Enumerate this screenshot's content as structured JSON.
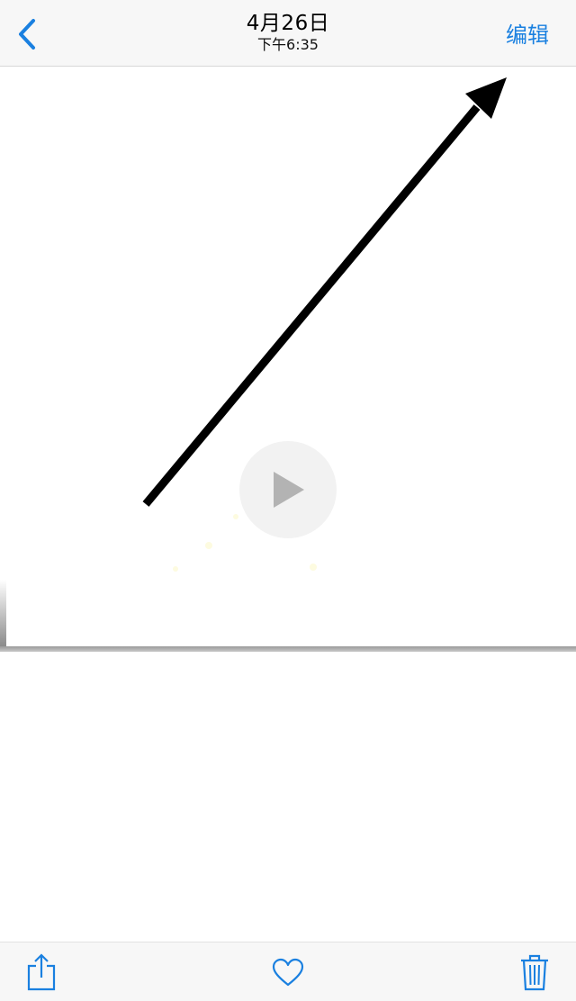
{
  "navbar": {
    "back_icon": "chevron-left-icon",
    "date": "4月26日",
    "time": "下午6:35",
    "edit_label": "编辑"
  },
  "media": {
    "content": "arrow-image",
    "play_icon": "play-icon"
  },
  "toolbar": {
    "share_icon": "share-icon",
    "favorite_icon": "heart-icon",
    "delete_icon": "trash-icon"
  },
  "colors": {
    "accent": "#1a80e0",
    "bar_background": "#f7f7f7",
    "arrow": "#000000",
    "play_glyph": "#b3b3b3"
  }
}
